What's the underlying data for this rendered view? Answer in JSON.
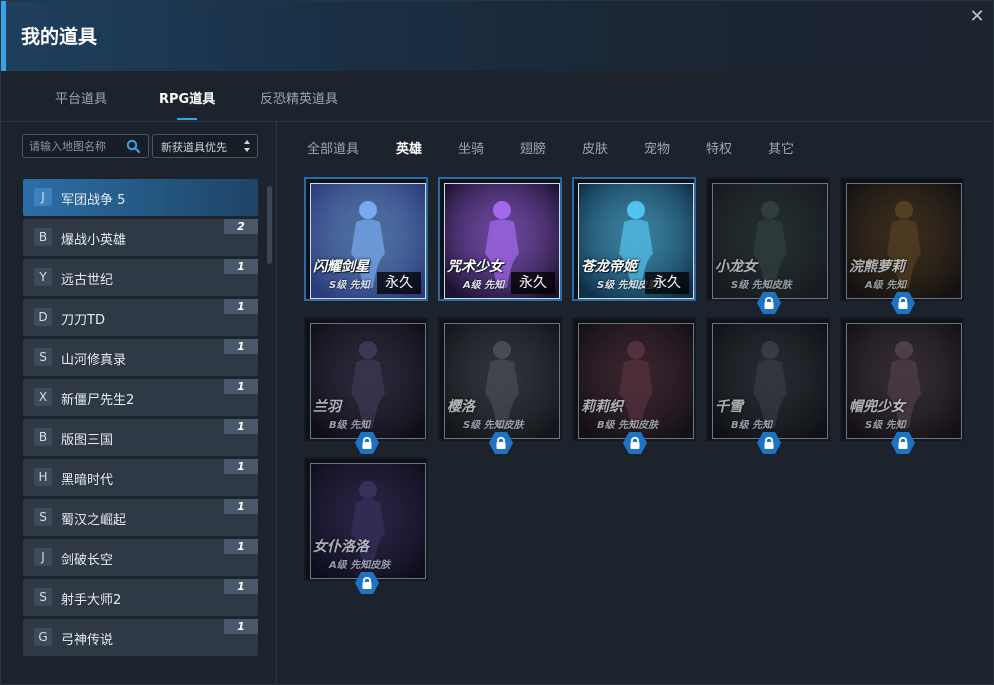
{
  "window": {
    "title": "我的道具"
  },
  "main_tabs": [
    {
      "label": "平台道具"
    },
    {
      "label": "RPG道具"
    },
    {
      "label": "反恐精英道具"
    }
  ],
  "search": {
    "placeholder": "请输入地图名称"
  },
  "sort": {
    "selected": "新获道具优先"
  },
  "maps": [
    {
      "letter": "J",
      "name": "军团战争 5",
      "count": ""
    },
    {
      "letter": "B",
      "name": "爆战小英雄",
      "count": "2"
    },
    {
      "letter": "Y",
      "name": "远古世纪",
      "count": "1"
    },
    {
      "letter": "D",
      "name": "刀刀TD",
      "count": "1"
    },
    {
      "letter": "S",
      "name": "山河修真录",
      "count": "1"
    },
    {
      "letter": "X",
      "name": "新僵尸先生2",
      "count": "1"
    },
    {
      "letter": "B",
      "name": "版图三国",
      "count": "1"
    },
    {
      "letter": "H",
      "name": "黑暗时代",
      "count": "1"
    },
    {
      "letter": "S",
      "name": "蜀汉之崛起",
      "count": "1"
    },
    {
      "letter": "J",
      "name": "剑破长空",
      "count": "1"
    },
    {
      "letter": "S",
      "name": "射手大师2",
      "count": "1"
    },
    {
      "letter": "G",
      "name": "弓神传说",
      "count": "1"
    }
  ],
  "category_tabs": [
    {
      "label": "全部道具"
    },
    {
      "label": "英雄"
    },
    {
      "label": "坐骑"
    },
    {
      "label": "翅膀"
    },
    {
      "label": "皮肤"
    },
    {
      "label": "宠物"
    },
    {
      "label": "特权"
    },
    {
      "label": "其它"
    }
  ],
  "items": [
    {
      "name": "闪耀剑星",
      "sub": "S级 先知",
      "badge": "永久",
      "owned": true,
      "colors": [
        "#2b3a7a",
        "#7fb6ff"
      ]
    },
    {
      "name": "咒术少女",
      "sub": "A级 先知",
      "badge": "永久",
      "owned": true,
      "colors": [
        "#1c1230",
        "#b070ff"
      ]
    },
    {
      "name": "苍龙帝姬",
      "sub": "S级 先知皮肤",
      "badge": "永久",
      "owned": true,
      "colors": [
        "#103048",
        "#5ad0ff"
      ]
    },
    {
      "name": "小龙女",
      "sub": "S级 先知皮肤",
      "badge": "",
      "owned": false,
      "colors": [
        "#2a2f34",
        "#6a8a80"
      ]
    },
    {
      "name": "浣熊萝莉",
      "sub": "A级 先知",
      "badge": "",
      "owned": false,
      "colors": [
        "#241c14",
        "#c08a40"
      ]
    },
    {
      "name": "兰羽",
      "sub": "B级 先知",
      "badge": "",
      "owned": false,
      "colors": [
        "#1a1622",
        "#8a78b0"
      ]
    },
    {
      "name": "樱洛",
      "sub": "S级 先知皮肤",
      "badge": "",
      "owned": false,
      "colors": [
        "#202428",
        "#a0a8b0"
      ]
    },
    {
      "name": "莉莉织",
      "sub": "B级 先知皮肤",
      "badge": "",
      "owned": false,
      "colors": [
        "#241a20",
        "#c06a80"
      ]
    },
    {
      "name": "千雪",
      "sub": "B级 先知",
      "badge": "",
      "owned": false,
      "colors": [
        "#1a1c20",
        "#7a8088"
      ]
    },
    {
      "name": "帽兜少女",
      "sub": "S级 先知",
      "badge": "",
      "owned": false,
      "colors": [
        "#221a20",
        "#b08898"
      ]
    },
    {
      "name": "女仆洛洛",
      "sub": "A级 先知皮肤",
      "badge": "",
      "owned": false,
      "colors": [
        "#1a1630",
        "#7a68c8"
      ]
    }
  ],
  "colors": {
    "accent": "#3aa0e8",
    "lock": "#1f73c4"
  }
}
